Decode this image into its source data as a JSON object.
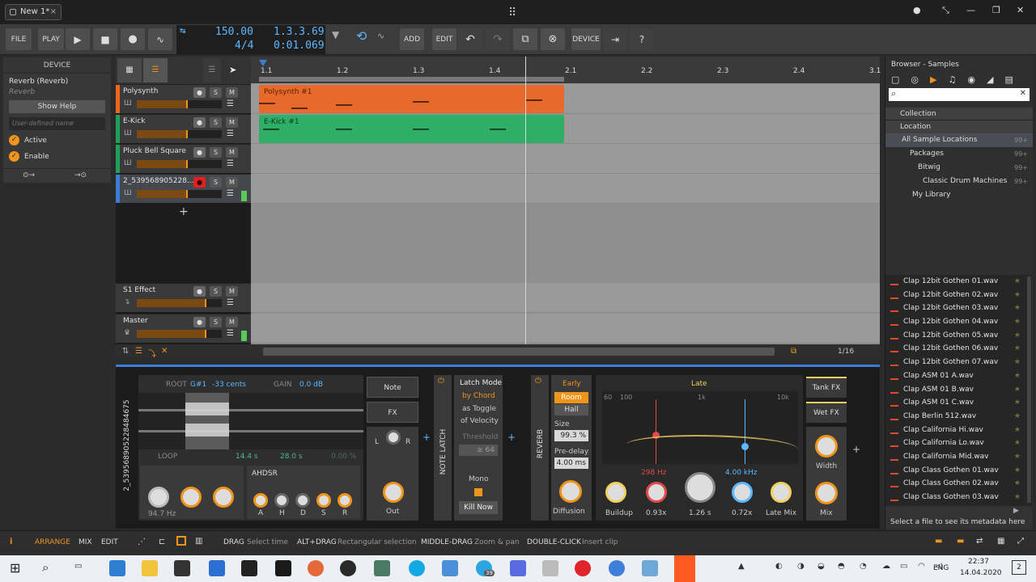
{
  "titlebar": {
    "tab_label": "New 1*",
    "tab_close": "×",
    "min": "—",
    "max": "❐",
    "close": "✕",
    "dot": "●",
    "restore": "⤡"
  },
  "toolbar": {
    "file": "FILE",
    "play_label": "PLAY",
    "add": "ADD",
    "edit": "EDIT",
    "device": "DEVICE",
    "tempo": "150.00",
    "signature": "4/4",
    "position": "1.3.3.69",
    "time": "0:01.069"
  },
  "device_panel": {
    "header": "DEVICE",
    "device_name": "Reverb (Reverb)",
    "device_type": "Reverb",
    "show_help": "Show Help",
    "user_name_placeholder": "User-defined name",
    "active": "Active",
    "enable": "Enable"
  },
  "tracks": [
    {
      "name": "Polysynth",
      "color": "#f0651c"
    },
    {
      "name": "E-Kick",
      "color": "#1fa15a"
    },
    {
      "name": "Pluck Bell Square",
      "color": "#1fa15a"
    },
    {
      "name": "2_539568905228...",
      "color": "#3b7dd6"
    }
  ],
  "fx_tracks": [
    {
      "name": "S1 Effect"
    },
    {
      "name": "Master"
    }
  ],
  "track_buttons": {
    "s": "S",
    "m": "M"
  },
  "add_track": "+",
  "ruler": {
    "ticks": [
      "1.1",
      "1.2",
      "1.3",
      "1.4",
      "2.1",
      "2.2",
      "2.3",
      "2.4",
      "3.1"
    ]
  },
  "clips": [
    {
      "name": "Polysynth #1",
      "color": "#e8692c"
    },
    {
      "name": "E-Kick #1",
      "color": "#2fae68"
    }
  ],
  "grid": "1/16",
  "sampler": {
    "track_id": "2_539568905228484675",
    "root_label": "ROOT",
    "root": "G#1",
    "cents": "-33 cents",
    "gain_label": "GAIN",
    "gain": "0.0 dB",
    "loop": "LOOP",
    "loop_start": "14.4 s",
    "loop_len": "28.0 s",
    "loop_pct": "0.00 %",
    "freq": "94.7 Hz",
    "env": "AHDSR",
    "env_labels": [
      "A",
      "H",
      "D",
      "S",
      "R"
    ],
    "note": "Note",
    "fx": "FX",
    "lr": [
      "L",
      "R"
    ],
    "out": "Out"
  },
  "note_latch": {
    "title": "NOTE LATCH",
    "latch_mode": "Latch Mode",
    "by_chord": "by Chord",
    "as_toggle": "as Toggle",
    "of_velocity": "of Velocity",
    "threshold": "Threshold",
    "threshold_val": "≥ 64",
    "mono": "Mono",
    "kill_now": "Kill Now"
  },
  "reverb": {
    "title": "REVERB",
    "early": "Early",
    "room": "Room",
    "hall": "Hall",
    "size_label": "Size",
    "size": "99.3 %",
    "predelay_label": "Pre-delay",
    "predelay": "4.00 ms",
    "diffusion": "Diffusion",
    "late": "Late",
    "freq_ticks": [
      "60",
      "100",
      "1k",
      "10k"
    ],
    "low_freq": "298 Hz",
    "high_freq": "4.00 kHz",
    "buildup": "Buildup",
    "mult": "0.93x",
    "decay": "1.26 s",
    "damp": "0.72x",
    "late_mix": "Late Mix",
    "tank_fx": "Tank FX",
    "wet_fx": "Wet FX",
    "width": "Width",
    "mix": "Mix"
  },
  "browser": {
    "title": "Browser - Samples",
    "collection": "Collection",
    "location": "Location",
    "locations": [
      {
        "label": "All Sample Locations",
        "count": "99+"
      },
      {
        "label": "Packages",
        "count": "99+"
      },
      {
        "label": "Bitwig",
        "count": "99+"
      },
      {
        "label": "Classic Drum Machines",
        "count": "99+"
      },
      {
        "label": "My Library",
        "count": ""
      }
    ],
    "files": [
      "Clap 12bit Gothen 01.wav",
      "Clap 12bit Gothen 02.wav",
      "Clap 12bit Gothen 03.wav",
      "Clap 12bit Gothen 04.wav",
      "Clap 12bit Gothen 05.wav",
      "Clap 12bit Gothen 06.wav",
      "Clap 12bit Gothen 07.wav",
      "Clap ASM 01 A.wav",
      "Clap ASM 01 B.wav",
      "Clap ASM 01 C.wav",
      "Clap Berlin 512.wav",
      "Clap California Hi.wav",
      "Clap California Lo.wav",
      "Clap California Mid.wav",
      "Clap Class Gothen 01.wav",
      "Clap Class Gothen 02.wav",
      "Clap Class Gothen 03.wav"
    ],
    "metadata_hint": "Select a file to see its metadata here"
  },
  "statusbar": {
    "info": "i",
    "arrange": "ARRANGE",
    "mix": "MIX",
    "edit": "EDIT",
    "hints": [
      {
        "key": "DRAG",
        "desc": "Select time"
      },
      {
        "key": "ALT+DRAG",
        "desc": "Rectangular selection"
      },
      {
        "key": "MIDDLE-DRAG",
        "desc": "Zoom & pan"
      },
      {
        "key": "DOUBLE-CLICK",
        "desc": "Insert clip"
      }
    ]
  },
  "taskbar": {
    "lang": "ENG",
    "time": "22:37",
    "date": "14.04.2020",
    "notif": "2",
    "badge": "39"
  },
  "icons": {
    "play": "▶",
    "stop": "■",
    "record": "●",
    "automation": "∿",
    "undo": "↶",
    "redo": "↷",
    "copy": "⧉",
    "cancel": "⊗",
    "export": "⇥",
    "help": "?",
    "arrow_up": "▲",
    "arrow_down": "▼",
    "menu": "☰",
    "pointer": "➤",
    "search": "⌕",
    "close_x": "✕",
    "tri": "◢",
    "star": "★",
    "power": "⏻",
    "plus": "+",
    "grid_9": "⠿",
    "tempo_tap": "↹",
    "loop": "⟲",
    "win": "⊞"
  }
}
